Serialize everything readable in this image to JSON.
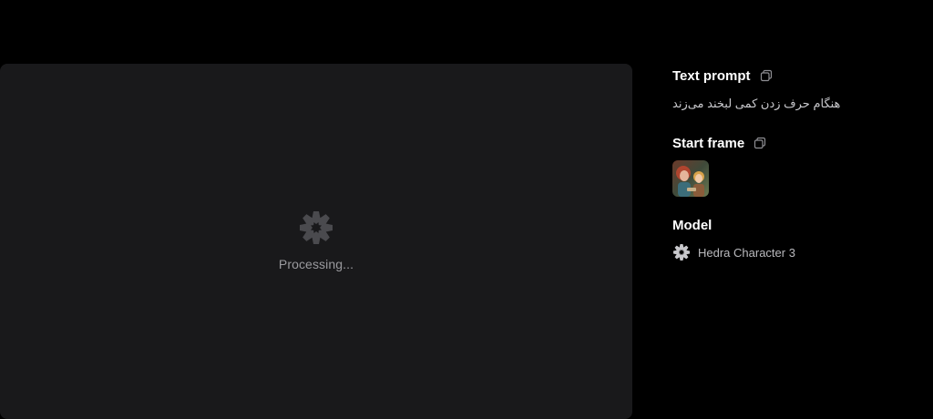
{
  "preview": {
    "status_text": "Processing..."
  },
  "details": {
    "text_prompt": {
      "title": "Text prompt",
      "value": "هنگام حرف زدن کمی لبخند می‌زند",
      "copy_icon": "copy-icon"
    },
    "start_frame": {
      "title": "Start frame",
      "copy_icon": "copy-icon",
      "thumbnail": "start-frame-image"
    },
    "model": {
      "title": "Model",
      "name": "Hedra Character 3",
      "icon": "hedra-logo-icon"
    }
  },
  "colors": {
    "background": "#000000",
    "panel": "#19191b",
    "loader": "#4a4a4e",
    "muted_text": "#9a9a9e"
  }
}
